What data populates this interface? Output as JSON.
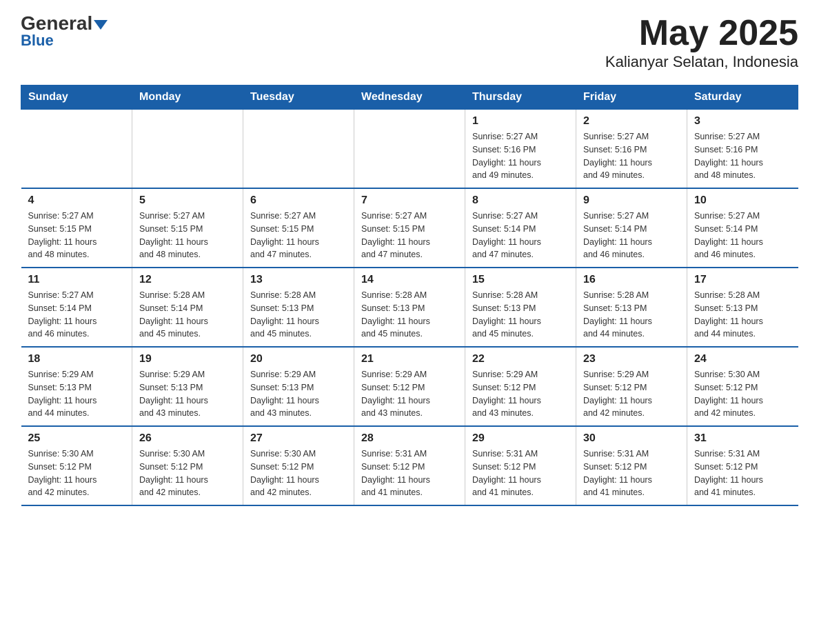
{
  "logo": {
    "general": "General",
    "blue": "Blue",
    "triangle": "▼"
  },
  "title": "May 2025",
  "subtitle": "Kalianyar Selatan, Indonesia",
  "days_of_week": [
    "Sunday",
    "Monday",
    "Tuesday",
    "Wednesday",
    "Thursday",
    "Friday",
    "Saturday"
  ],
  "weeks": [
    [
      {
        "day": "",
        "info": ""
      },
      {
        "day": "",
        "info": ""
      },
      {
        "day": "",
        "info": ""
      },
      {
        "day": "",
        "info": ""
      },
      {
        "day": "1",
        "info": "Sunrise: 5:27 AM\nSunset: 5:16 PM\nDaylight: 11 hours\nand 49 minutes."
      },
      {
        "day": "2",
        "info": "Sunrise: 5:27 AM\nSunset: 5:16 PM\nDaylight: 11 hours\nand 49 minutes."
      },
      {
        "day": "3",
        "info": "Sunrise: 5:27 AM\nSunset: 5:16 PM\nDaylight: 11 hours\nand 48 minutes."
      }
    ],
    [
      {
        "day": "4",
        "info": "Sunrise: 5:27 AM\nSunset: 5:15 PM\nDaylight: 11 hours\nand 48 minutes."
      },
      {
        "day": "5",
        "info": "Sunrise: 5:27 AM\nSunset: 5:15 PM\nDaylight: 11 hours\nand 48 minutes."
      },
      {
        "day": "6",
        "info": "Sunrise: 5:27 AM\nSunset: 5:15 PM\nDaylight: 11 hours\nand 47 minutes."
      },
      {
        "day": "7",
        "info": "Sunrise: 5:27 AM\nSunset: 5:15 PM\nDaylight: 11 hours\nand 47 minutes."
      },
      {
        "day": "8",
        "info": "Sunrise: 5:27 AM\nSunset: 5:14 PM\nDaylight: 11 hours\nand 47 minutes."
      },
      {
        "day": "9",
        "info": "Sunrise: 5:27 AM\nSunset: 5:14 PM\nDaylight: 11 hours\nand 46 minutes."
      },
      {
        "day": "10",
        "info": "Sunrise: 5:27 AM\nSunset: 5:14 PM\nDaylight: 11 hours\nand 46 minutes."
      }
    ],
    [
      {
        "day": "11",
        "info": "Sunrise: 5:27 AM\nSunset: 5:14 PM\nDaylight: 11 hours\nand 46 minutes."
      },
      {
        "day": "12",
        "info": "Sunrise: 5:28 AM\nSunset: 5:14 PM\nDaylight: 11 hours\nand 45 minutes."
      },
      {
        "day": "13",
        "info": "Sunrise: 5:28 AM\nSunset: 5:13 PM\nDaylight: 11 hours\nand 45 minutes."
      },
      {
        "day": "14",
        "info": "Sunrise: 5:28 AM\nSunset: 5:13 PM\nDaylight: 11 hours\nand 45 minutes."
      },
      {
        "day": "15",
        "info": "Sunrise: 5:28 AM\nSunset: 5:13 PM\nDaylight: 11 hours\nand 45 minutes."
      },
      {
        "day": "16",
        "info": "Sunrise: 5:28 AM\nSunset: 5:13 PM\nDaylight: 11 hours\nand 44 minutes."
      },
      {
        "day": "17",
        "info": "Sunrise: 5:28 AM\nSunset: 5:13 PM\nDaylight: 11 hours\nand 44 minutes."
      }
    ],
    [
      {
        "day": "18",
        "info": "Sunrise: 5:29 AM\nSunset: 5:13 PM\nDaylight: 11 hours\nand 44 minutes."
      },
      {
        "day": "19",
        "info": "Sunrise: 5:29 AM\nSunset: 5:13 PM\nDaylight: 11 hours\nand 43 minutes."
      },
      {
        "day": "20",
        "info": "Sunrise: 5:29 AM\nSunset: 5:13 PM\nDaylight: 11 hours\nand 43 minutes."
      },
      {
        "day": "21",
        "info": "Sunrise: 5:29 AM\nSunset: 5:12 PM\nDaylight: 11 hours\nand 43 minutes."
      },
      {
        "day": "22",
        "info": "Sunrise: 5:29 AM\nSunset: 5:12 PM\nDaylight: 11 hours\nand 43 minutes."
      },
      {
        "day": "23",
        "info": "Sunrise: 5:29 AM\nSunset: 5:12 PM\nDaylight: 11 hours\nand 42 minutes."
      },
      {
        "day": "24",
        "info": "Sunrise: 5:30 AM\nSunset: 5:12 PM\nDaylight: 11 hours\nand 42 minutes."
      }
    ],
    [
      {
        "day": "25",
        "info": "Sunrise: 5:30 AM\nSunset: 5:12 PM\nDaylight: 11 hours\nand 42 minutes."
      },
      {
        "day": "26",
        "info": "Sunrise: 5:30 AM\nSunset: 5:12 PM\nDaylight: 11 hours\nand 42 minutes."
      },
      {
        "day": "27",
        "info": "Sunrise: 5:30 AM\nSunset: 5:12 PM\nDaylight: 11 hours\nand 42 minutes."
      },
      {
        "day": "28",
        "info": "Sunrise: 5:31 AM\nSunset: 5:12 PM\nDaylight: 11 hours\nand 41 minutes."
      },
      {
        "day": "29",
        "info": "Sunrise: 5:31 AM\nSunset: 5:12 PM\nDaylight: 11 hours\nand 41 minutes."
      },
      {
        "day": "30",
        "info": "Sunrise: 5:31 AM\nSunset: 5:12 PM\nDaylight: 11 hours\nand 41 minutes."
      },
      {
        "day": "31",
        "info": "Sunrise: 5:31 AM\nSunset: 5:12 PM\nDaylight: 11 hours\nand 41 minutes."
      }
    ]
  ]
}
